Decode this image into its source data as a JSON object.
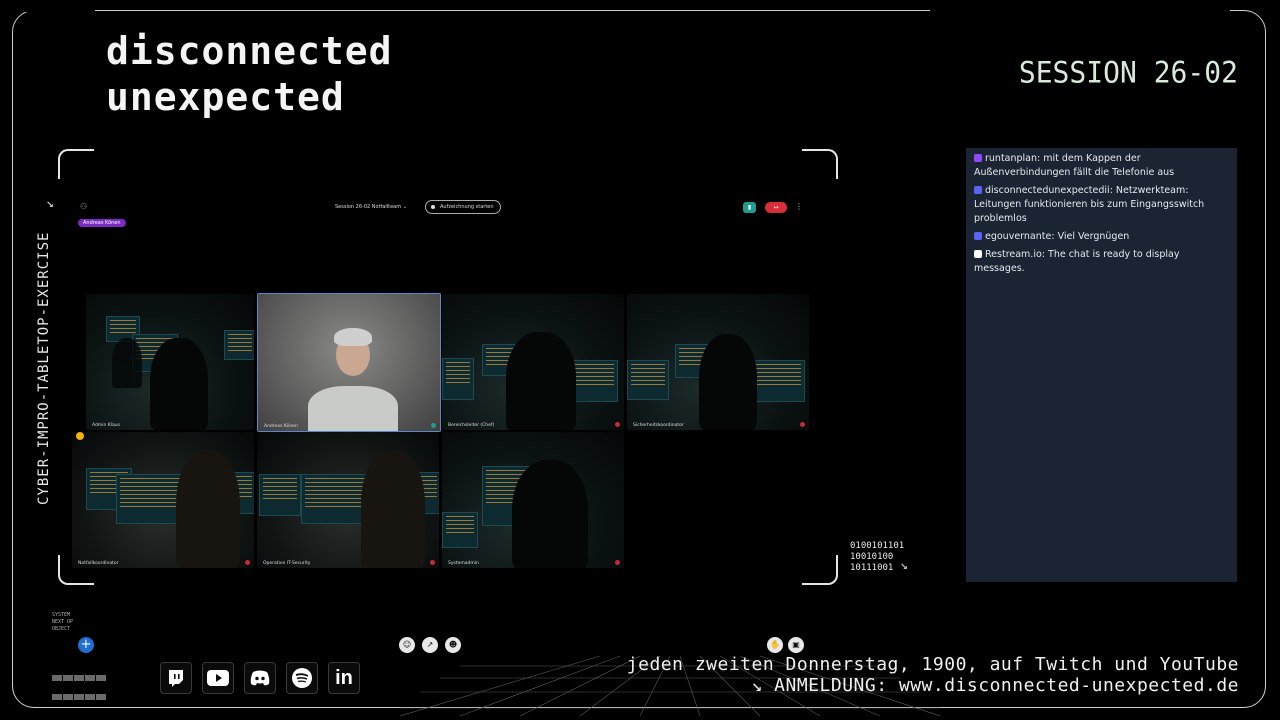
{
  "brand": {
    "line1": "disconnected",
    "line2": "unexpected"
  },
  "session_label": "SESSION 26-02",
  "vertical_label": "CYBER-IMPRO-TABLETOP-EXERCISE",
  "binary_lines": [
    "0100101101",
    "10010100",
    "10111001"
  ],
  "meeting": {
    "participant_chip": "Andreas Könen",
    "session_select": "Session 26-02 Notfallteam",
    "record_button": "Aufzeichnung starten",
    "tiles": [
      {
        "name": "Admin Klaus"
      },
      {
        "name": "Andreas Könen"
      },
      {
        "name": "Bereichsleiter (Chef)"
      },
      {
        "name": "Sicherheitskoordinator"
      },
      {
        "name": "Notfallkoordinator"
      },
      {
        "name": "Operative IT-Security"
      },
      {
        "name": "Systemadmin"
      }
    ]
  },
  "chat": {
    "messages": [
      {
        "user": "runtanplan",
        "text": ": mit dem Kappen der Außenverbindungen fällt die Telefonie aus",
        "icon_color": "#9146ff"
      },
      {
        "user": "disconnectedunexpectedii",
        "text": ": Netzwerkteam: Leitungen funktionieren bis zum Eingangsswitch problemlos",
        "icon_color": "#5865f2"
      },
      {
        "user": "egouvernante",
        "text": ": Viel Vergnügen",
        "icon_color": "#5865f2"
      },
      {
        "user": "Restream.io",
        "text": ": The chat is ready to display messages.",
        "icon_color": "#ffffff"
      }
    ]
  },
  "tagline": {
    "line1": "jeden zweiten Donnerstag, 1900, auf Twitch und YouTube",
    "line2": "↘ ANMELDUNG: www.disconnected-unexpected.de"
  },
  "social_icons": [
    "twitch-icon",
    "youtube-icon",
    "discord-icon",
    "spotify-icon",
    "linkedin-icon"
  ],
  "sys_text": [
    "SYSTEM",
    "",
    "NEXT OP",
    "OBJECT"
  ]
}
